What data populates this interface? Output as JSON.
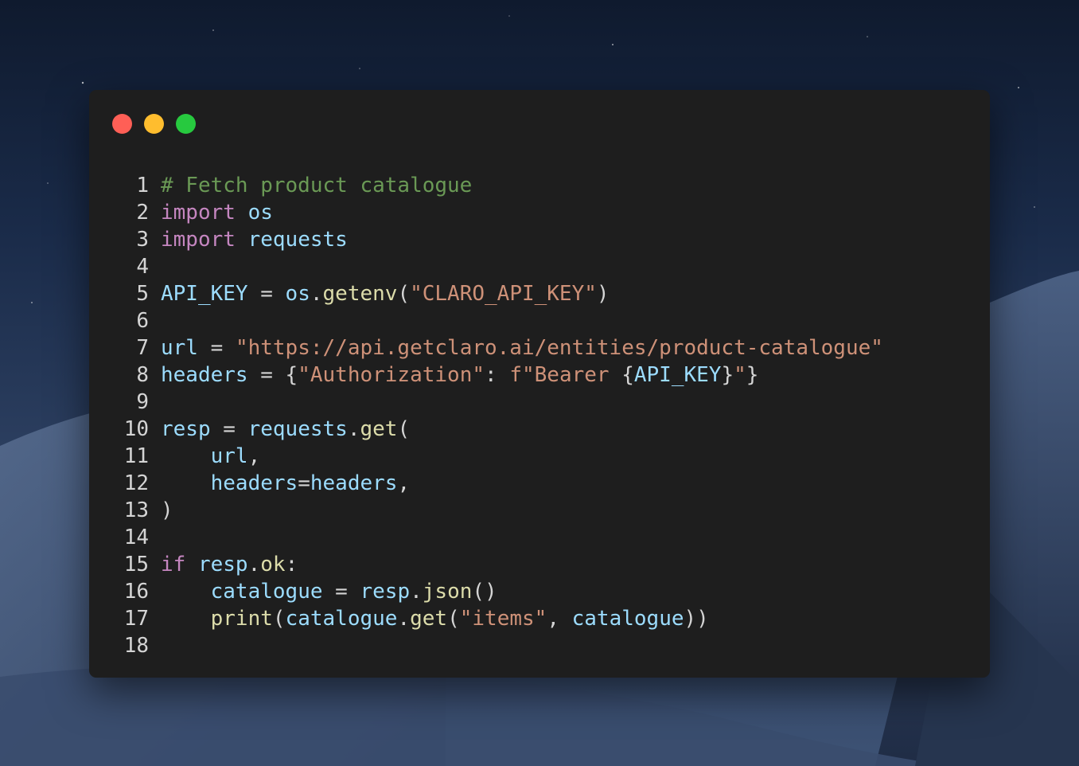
{
  "colors": {
    "close": "#ff5f56",
    "minimize": "#ffbd2e",
    "zoom": "#27c93f",
    "window_bg": "#1e1e1e",
    "comment": "#6a9955",
    "keyword": "#c586c0",
    "variable": "#9cdcfe",
    "function": "#dcdcaa",
    "string": "#ce9178",
    "plain": "#d4d4d4"
  },
  "window_controls": [
    {
      "name": "close-button",
      "color": "#ff5f56"
    },
    {
      "name": "minimize-button",
      "color": "#ffbd2e"
    },
    {
      "name": "zoom-button",
      "color": "#27c93f"
    }
  ],
  "code": {
    "language": "python",
    "lines": [
      {
        "n": "1",
        "tokens": [
          {
            "t": "comment",
            "v": "# Fetch product catalogue"
          }
        ]
      },
      {
        "n": "2",
        "tokens": [
          {
            "t": "kw",
            "v": "import"
          },
          {
            "t": "op",
            "v": " "
          },
          {
            "t": "var",
            "v": "os"
          }
        ]
      },
      {
        "n": "3",
        "tokens": [
          {
            "t": "kw",
            "v": "import"
          },
          {
            "t": "op",
            "v": " "
          },
          {
            "t": "var",
            "v": "requests"
          }
        ]
      },
      {
        "n": "4",
        "tokens": []
      },
      {
        "n": "5",
        "tokens": [
          {
            "t": "var",
            "v": "API_KEY"
          },
          {
            "t": "op",
            "v": " = "
          },
          {
            "t": "var",
            "v": "os"
          },
          {
            "t": "op",
            "v": "."
          },
          {
            "t": "fn",
            "v": "getenv"
          },
          {
            "t": "op",
            "v": "("
          },
          {
            "t": "str",
            "v": "\"CLARO_API_KEY\""
          },
          {
            "t": "op",
            "v": ")"
          }
        ]
      },
      {
        "n": "6",
        "tokens": []
      },
      {
        "n": "7",
        "tokens": [
          {
            "t": "var",
            "v": "url"
          },
          {
            "t": "op",
            "v": " = "
          },
          {
            "t": "str",
            "v": "\"https://api.getclaro.ai/entities/product-catalogue\""
          }
        ]
      },
      {
        "n": "8",
        "tokens": [
          {
            "t": "var",
            "v": "headers"
          },
          {
            "t": "op",
            "v": " = {"
          },
          {
            "t": "str",
            "v": "\"Authorization\""
          },
          {
            "t": "op",
            "v": ": "
          },
          {
            "t": "str",
            "v": "f\"Bearer "
          },
          {
            "t": "op",
            "v": "{"
          },
          {
            "t": "var",
            "v": "API_KEY"
          },
          {
            "t": "op",
            "v": "}"
          },
          {
            "t": "str",
            "v": "\""
          },
          {
            "t": "op",
            "v": "}"
          }
        ]
      },
      {
        "n": "9",
        "tokens": []
      },
      {
        "n": "10",
        "tokens": [
          {
            "t": "var",
            "v": "resp"
          },
          {
            "t": "op",
            "v": " = "
          },
          {
            "t": "var",
            "v": "requests"
          },
          {
            "t": "op",
            "v": "."
          },
          {
            "t": "fn",
            "v": "get"
          },
          {
            "t": "op",
            "v": "("
          }
        ]
      },
      {
        "n": "11",
        "tokens": [
          {
            "t": "op",
            "v": "    "
          },
          {
            "t": "var",
            "v": "url"
          },
          {
            "t": "op",
            "v": ","
          }
        ]
      },
      {
        "n": "12",
        "tokens": [
          {
            "t": "op",
            "v": "    "
          },
          {
            "t": "var",
            "v": "headers"
          },
          {
            "t": "op",
            "v": "="
          },
          {
            "t": "var",
            "v": "headers"
          },
          {
            "t": "op",
            "v": ","
          }
        ]
      },
      {
        "n": "13",
        "tokens": [
          {
            "t": "op",
            "v": ")"
          }
        ]
      },
      {
        "n": "14",
        "tokens": []
      },
      {
        "n": "15",
        "tokens": [
          {
            "t": "kw",
            "v": "if"
          },
          {
            "t": "op",
            "v": " "
          },
          {
            "t": "var",
            "v": "resp"
          },
          {
            "t": "op",
            "v": "."
          },
          {
            "t": "fn",
            "v": "ok"
          },
          {
            "t": "op",
            "v": ":"
          }
        ]
      },
      {
        "n": "16",
        "tokens": [
          {
            "t": "op",
            "v": "    "
          },
          {
            "t": "var",
            "v": "catalogue"
          },
          {
            "t": "op",
            "v": " = "
          },
          {
            "t": "var",
            "v": "resp"
          },
          {
            "t": "op",
            "v": "."
          },
          {
            "t": "fn",
            "v": "json"
          },
          {
            "t": "op",
            "v": "()"
          }
        ]
      },
      {
        "n": "17",
        "tokens": [
          {
            "t": "op",
            "v": "    "
          },
          {
            "t": "fn",
            "v": "print"
          },
          {
            "t": "op",
            "v": "("
          },
          {
            "t": "var",
            "v": "catalogue"
          },
          {
            "t": "op",
            "v": "."
          },
          {
            "t": "fn",
            "v": "get"
          },
          {
            "t": "op",
            "v": "("
          },
          {
            "t": "str",
            "v": "\"items\""
          },
          {
            "t": "op",
            "v": ", "
          },
          {
            "t": "var",
            "v": "catalogue"
          },
          {
            "t": "op",
            "v": "))"
          }
        ]
      },
      {
        "n": "18",
        "tokens": []
      }
    ]
  }
}
